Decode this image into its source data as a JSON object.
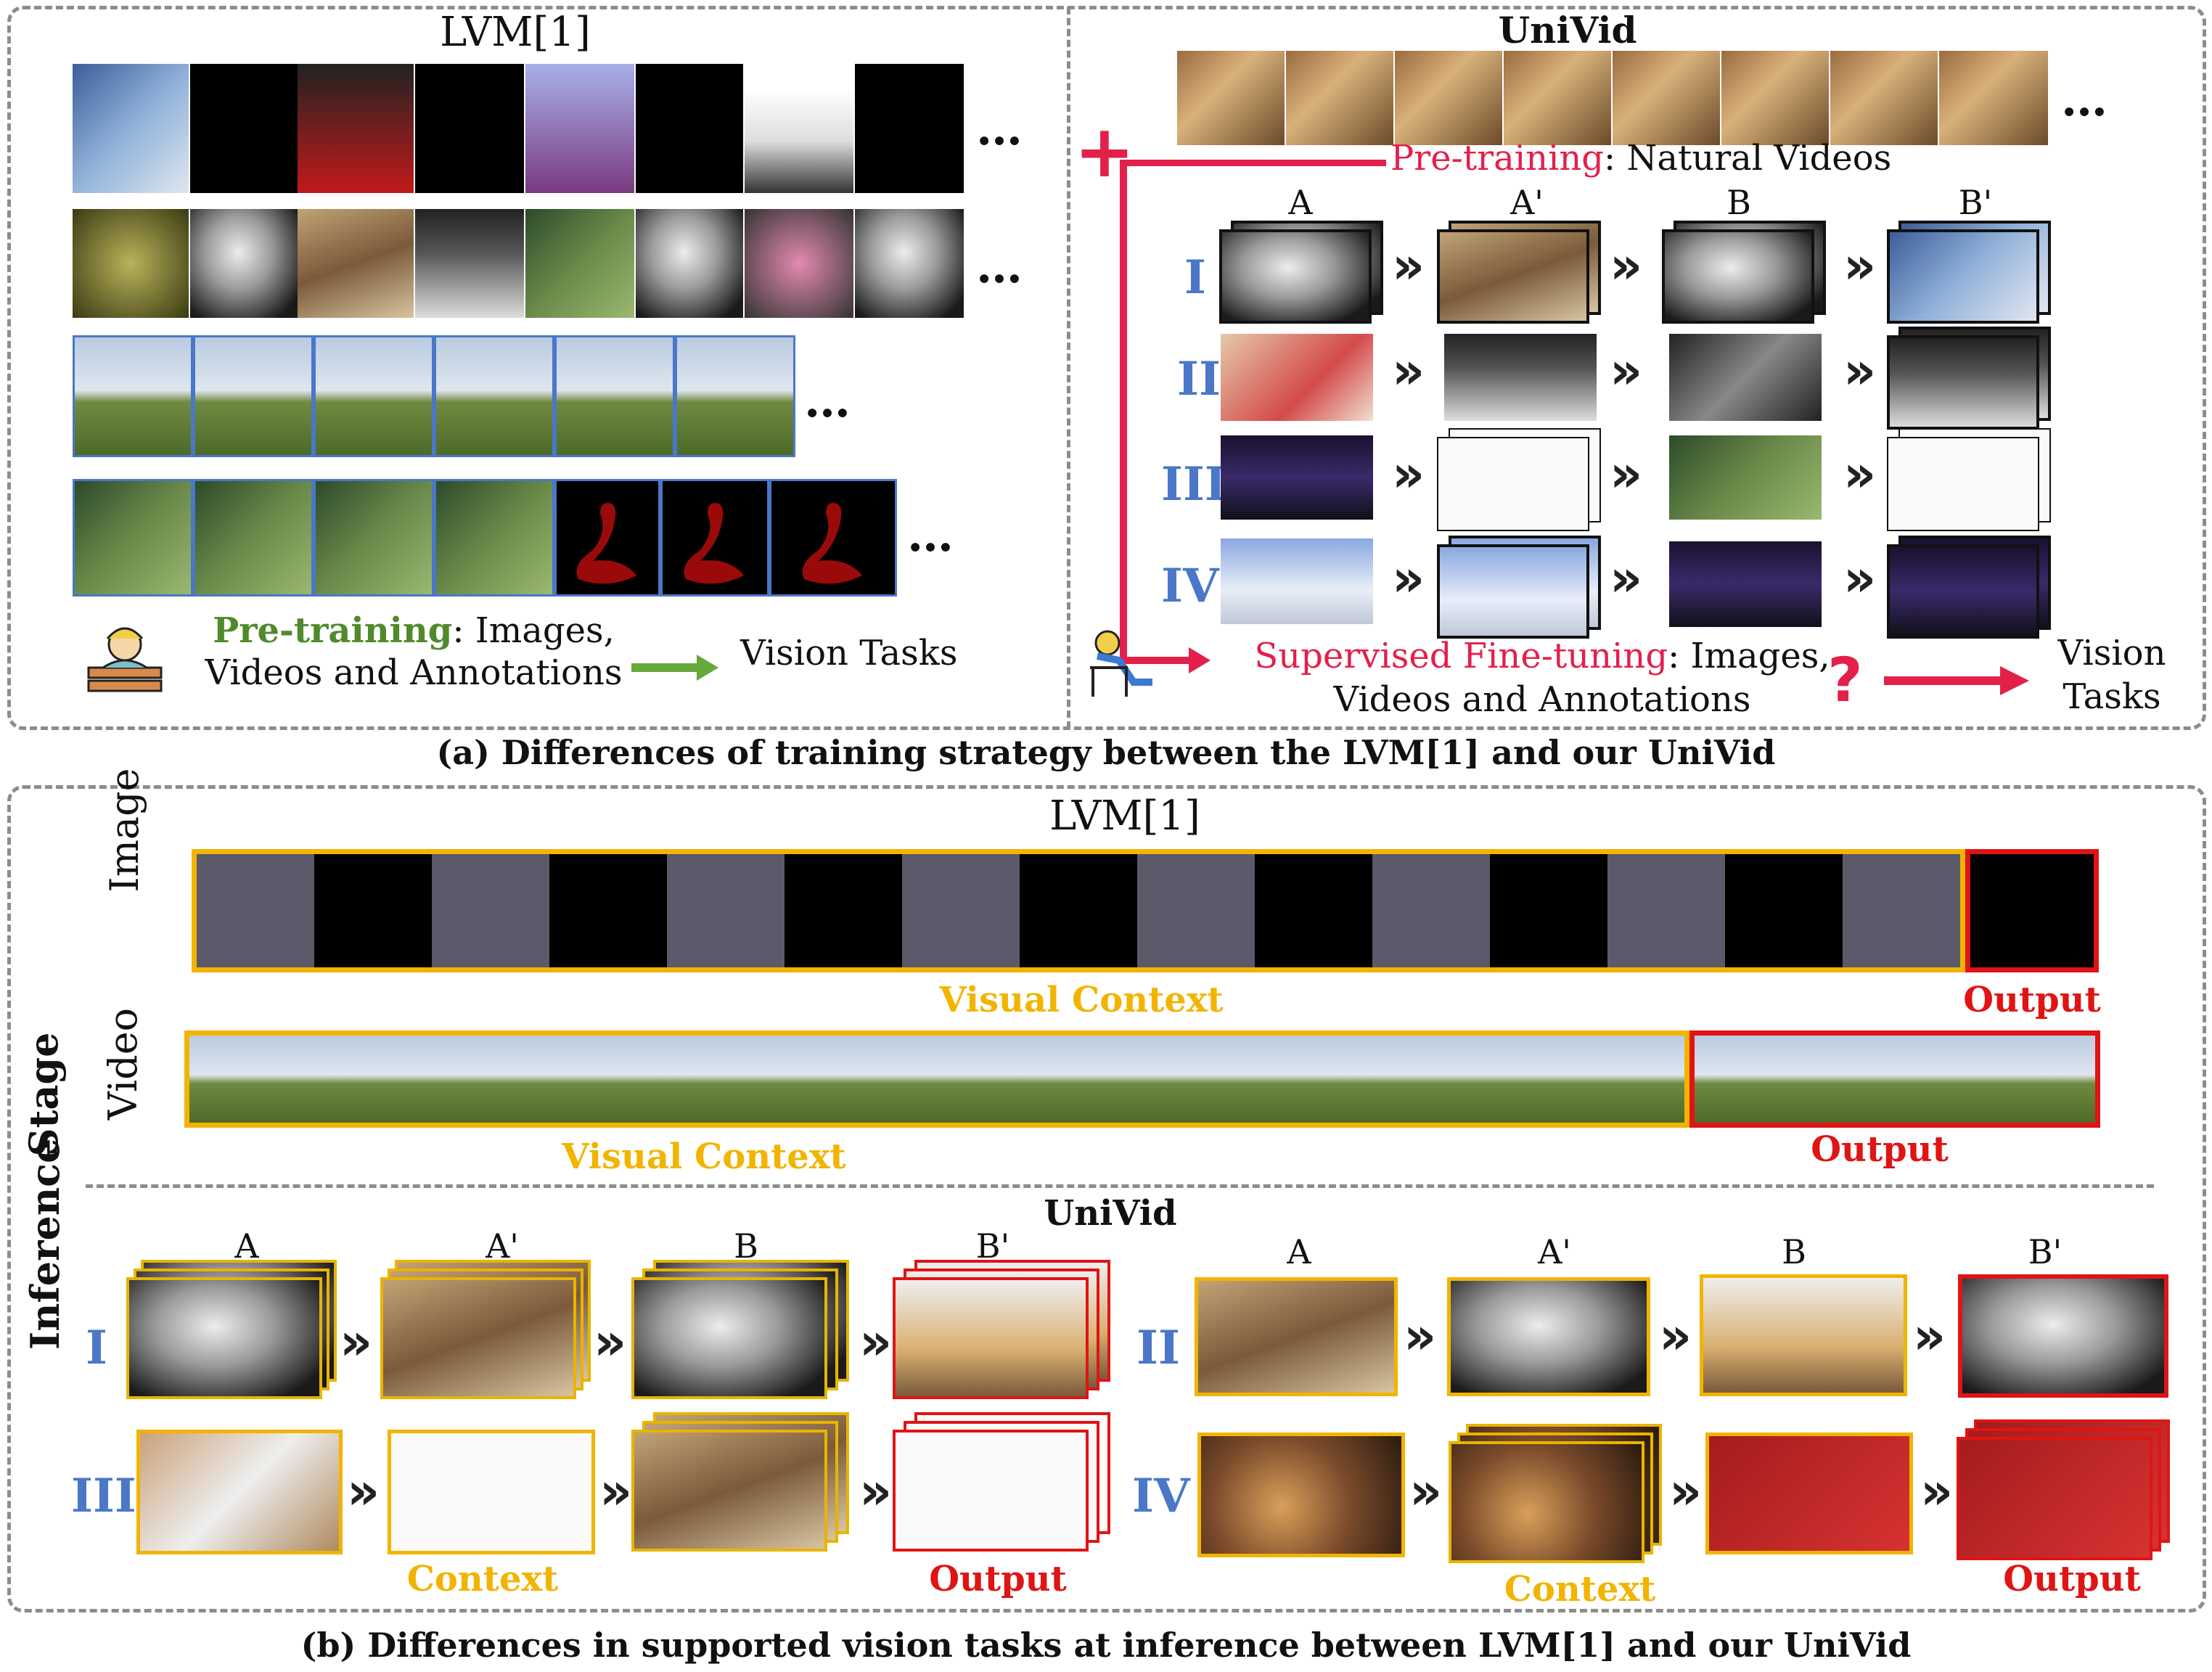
{
  "panel_a": {
    "left_title": "LVM[1]",
    "right_title": "UniVid",
    "plus": "+",
    "dots": "…",
    "pretrain_left_label": "Pre-training",
    "pretrain_left_rest1": ": Images,",
    "pretrain_left_rest2": "Videos and Annotations",
    "vision_tasks": "Vision Tasks",
    "pretrain_right_label": "Pre-training",
    "pretrain_right_rest": ": Natural Videos",
    "col_headers": [
      "A",
      "A'",
      "B",
      "B'"
    ],
    "rows": [
      "I",
      "II",
      "III",
      "IV"
    ],
    "sft_label": "Supervised Fine-tuning",
    "sft_rest1": ":  Images,",
    "sft_rest2": "Videos and Annotations",
    "question": "?",
    "vision_tasks_r1": "Vision",
    "vision_tasks_r2": "Tasks",
    "caption": "(a) Differences of training strategy  between the LVM[1] and our UniVid"
  },
  "panel_b": {
    "lvm_title": "LVM[1]",
    "image_label": "Image",
    "video_label": "Video",
    "stage_label": "Stage",
    "inference_label": "Inference",
    "visual_context": "Visual Context",
    "output": "Output",
    "univid_title": "UniVid",
    "col_headers": [
      "A",
      "A'",
      "B",
      "B'"
    ],
    "rows": [
      "I",
      "II",
      "III",
      "IV"
    ],
    "context": "Context",
    "caption": "(b) Differences in supported vision tasks at inference between LVM[1] and our UniVid"
  },
  "colors": {
    "yellow": "#f2b400",
    "red": "#e01414",
    "pink": "#e3204a",
    "green": "#4f8a2b",
    "blue_roman": "#4a77c8",
    "dashed": "#8c8c8c"
  },
  "arrow_glyph": "»",
  "arrow_right_glyph": "→"
}
